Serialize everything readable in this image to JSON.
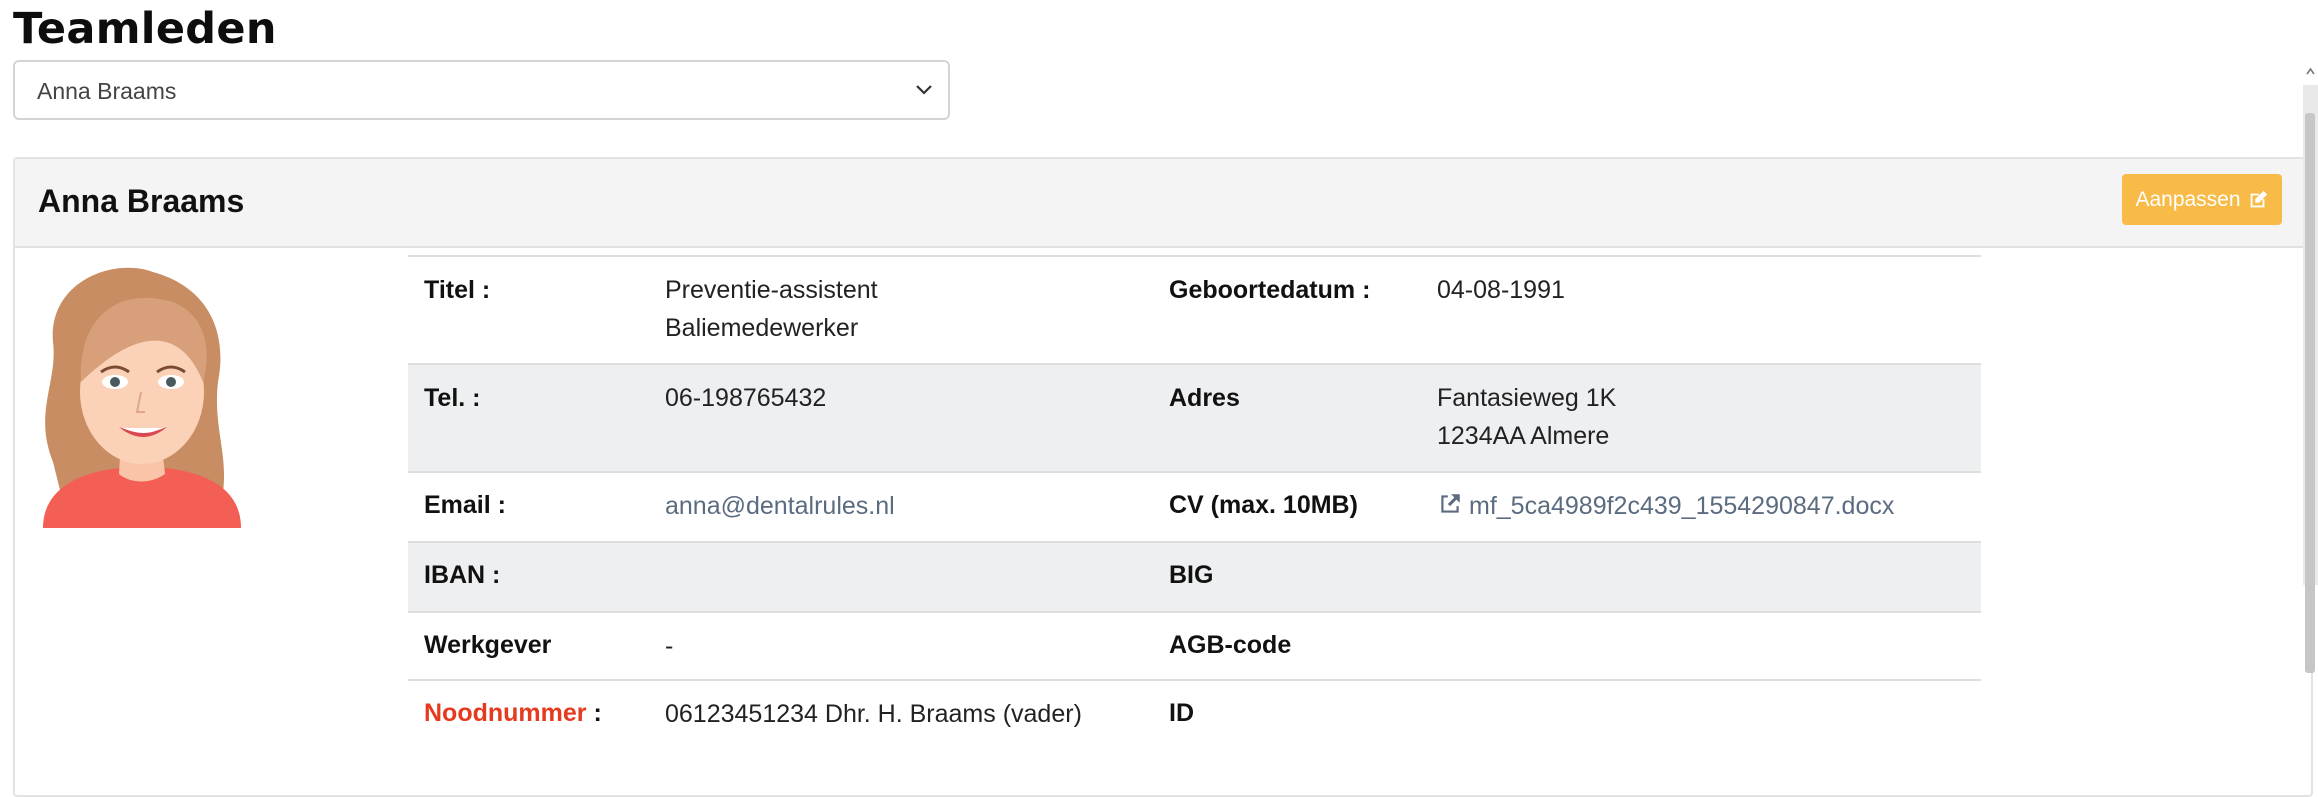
{
  "page": {
    "title": "Teamleden"
  },
  "member_select": {
    "selected": "Anna Braams"
  },
  "card": {
    "name": "Anna Braams",
    "edit_label": "Aanpassen"
  },
  "details": {
    "titel": {
      "label": "Titel :",
      "lines": [
        "Preventie-assistent",
        "Baliemedewerker"
      ]
    },
    "geboortedatum": {
      "label": "Geboortedatum :",
      "value": "04-08-1991"
    },
    "tel": {
      "label": "Tel. :",
      "value": "06-198765432"
    },
    "adres": {
      "label": "Adres",
      "lines": [
        "Fantasieweg 1K",
        "1234AA Almere"
      ]
    },
    "email": {
      "label": "Email :",
      "value": "anna@dentalrules.nl"
    },
    "cv": {
      "label": "CV (max. 10MB)",
      "value": "mf_5ca4989f2c439_1554290847.docx"
    },
    "iban": {
      "label": "IBAN :",
      "value": ""
    },
    "big": {
      "label": "BIG",
      "value": ""
    },
    "werkgever": {
      "label": "Werkgever",
      "value": "-"
    },
    "agb": {
      "label": "AGB-code",
      "value": ""
    },
    "noodnummer": {
      "label": "Noodnummer",
      "label_suffix": " :",
      "value": "06123451234 Dhr. H. Braams (vader)"
    },
    "id": {
      "label": "ID",
      "value": ""
    }
  },
  "colors": {
    "accent": "#f8bb47",
    "emergency": "#e53a1e",
    "link": "#5b6b80"
  },
  "icons": {
    "dropdown": "chevron-down-icon",
    "edit": "edit-icon",
    "external": "external-link-icon"
  }
}
